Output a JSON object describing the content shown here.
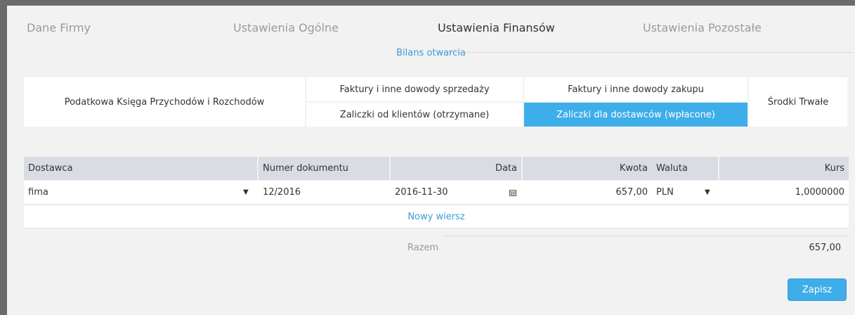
{
  "top_tabs": [
    "Dane Firmy",
    "Ustawienia Ogólne",
    "Ustawienia Finansów",
    "Ustawienia Pozostałe"
  ],
  "opening_balance_link": "Bilans otwarcia",
  "documents": {
    "ledger": "Podatkowa Księga Przychodów i Rozchodów",
    "sales_invoices": "Faktury i inne dowody sprzedaży",
    "purchase_invoices": "Faktury i inne dowody zakupu",
    "fixed_assets": "Środki Trwałe",
    "customer_advances": "Zaliczki od klientów (otrzymane)",
    "supplier_advances": "Zaliczki dla dostawców (wpłacone)"
  },
  "table": {
    "headers": {
      "supplier": "Dostawca",
      "doc_number": "Numer dokumentu",
      "date": "Data",
      "amount": "Kwota",
      "currency": "Waluta",
      "rate": "Kurs"
    },
    "row": {
      "supplier": "fima",
      "doc_number": "12/2016",
      "date": "2016-11-30",
      "amount": "657,00",
      "currency": "PLN",
      "rate": "1,0000000"
    },
    "new_row": "Nowy wiersz"
  },
  "summary": {
    "label": "Razem",
    "value": "657,00"
  },
  "save_label": "Zapisz",
  "colors": {
    "accent": "#3daee9",
    "link": "#3a9bd9",
    "header_bg": "#d9dce3",
    "panel_bg": "#f2f2f2"
  }
}
